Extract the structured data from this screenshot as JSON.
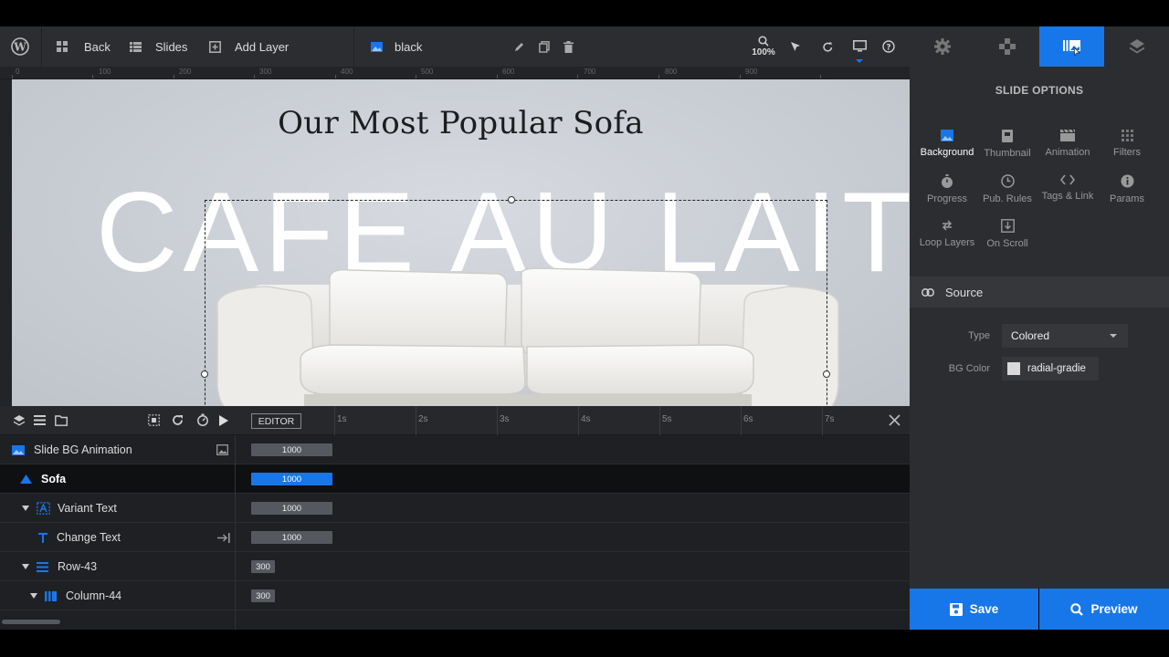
{
  "toolbar": {
    "back_label": "Back",
    "slides_label": "Slides",
    "add_layer_label": "Add Layer",
    "slide_name": "black",
    "zoom": "100%"
  },
  "ruler": {
    "h_marks": [
      "0",
      "100",
      "200",
      "300",
      "400",
      "500",
      "600",
      "700",
      "800",
      "900"
    ]
  },
  "canvas": {
    "title": "Our Most Popular Sofa",
    "big_text": "CAFE AU LAIT"
  },
  "timeline": {
    "editor_label": "EDITOR",
    "time_marks": [
      "1s",
      "2s",
      "3s",
      "4s",
      "5s",
      "6s",
      "7s"
    ],
    "rows": [
      {
        "name": "Slide BG Animation",
        "value": "1000"
      },
      {
        "name": "Sofa",
        "value": "1000"
      },
      {
        "name": "Variant Text",
        "value": "1000"
      },
      {
        "name": "Change Text",
        "value": "1000"
      },
      {
        "name": "Row-43",
        "value": "300"
      },
      {
        "name": "Column-44",
        "value": "300"
      }
    ]
  },
  "panel": {
    "title": "SLIDE OPTIONS",
    "options": [
      "Background",
      "Thumbnail",
      "Animation",
      "Filters",
      "Progress",
      "Pub. Rules",
      "Tags & Link",
      "Params",
      "Loop Layers",
      "On Scroll"
    ],
    "source_label": "Source",
    "type_label": "Type",
    "type_value": "Colored",
    "bgcolor_label": "BG Color",
    "bgcolor_value": "radial-gradie"
  },
  "buttons": {
    "save": "Save",
    "preview": "Preview"
  },
  "colors": {
    "accent": "#1877e8",
    "toolbar_bg": "#2b2d30",
    "timeline_bg": "#1f2023"
  }
}
